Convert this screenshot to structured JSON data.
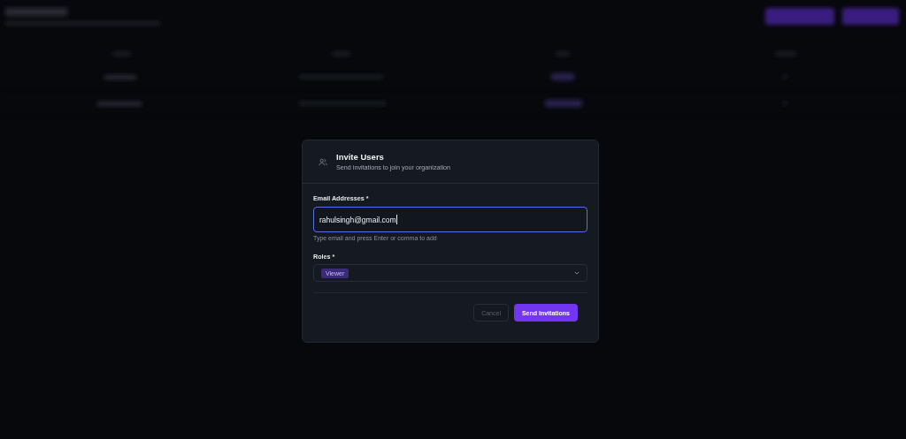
{
  "dialog": {
    "title": "Invite Users",
    "subtitle": "Send invitations to join your organization",
    "email_field": {
      "label": "Email Addresses *",
      "value": "rahulsingh@gmail.com",
      "focused": true,
      "hint": "Type email and press Enter or comma to add"
    },
    "roles_field": {
      "label": "Roles *",
      "tags": [
        "Viewer"
      ]
    },
    "buttons": [
      {
        "label": "Cancel",
        "kind": "secondary",
        "disabled": true
      },
      {
        "label": "Send Invitations",
        "kind": "primary",
        "disabled": false
      }
    ]
  }
}
